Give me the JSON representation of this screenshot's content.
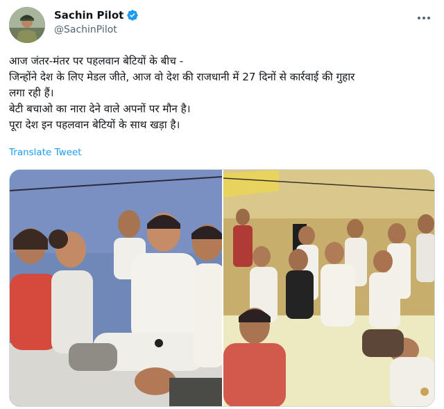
{
  "tweet": {
    "author_name": "Sachin Pilot",
    "author_handle": "@SachinPilot",
    "text_lines": [
      "आज जंतर-मंतर पर पहलवान बेटियों के बीच -",
      "जिन्होंने देश के लिए मेडल जीते, आज वो देश की राजधानी में 27 दिनों से कार्रवाई की गुहार",
      "लगा रही हैं।",
      "बेटी बचाओ का नारा देने वाले अपनों पर मौन है।",
      "पूरा देश इन पहलवान बेटियों के साथ खड़ा है।"
    ],
    "translate_label": "Translate Tweet"
  },
  "icons": {
    "verified": "verified-badge-icon",
    "more": "more-options-icon"
  },
  "colors": {
    "link": "#1d9bf0",
    "secondary_text": "#536471",
    "verified_badge": "#1d9bf0"
  }
}
